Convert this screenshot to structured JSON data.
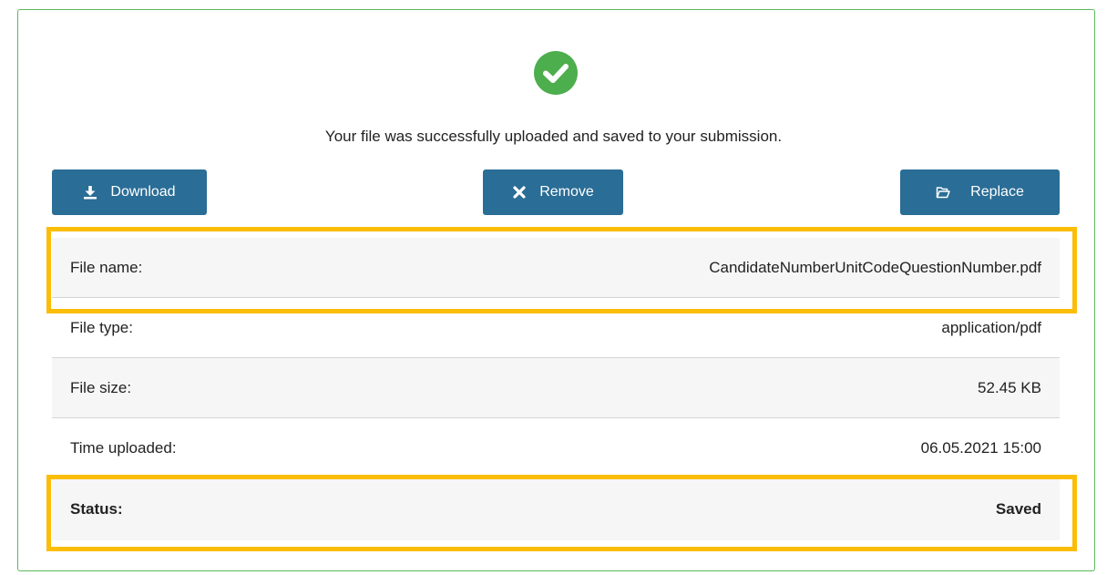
{
  "upload": {
    "message": "Your file was successfully uploaded and saved to your submission.",
    "success_icon": "check-circle-icon",
    "success_color": "#4cae4c"
  },
  "actions": {
    "download_label": "Download",
    "download_icon": "download-icon",
    "remove_label": "Remove",
    "remove_icon": "close-icon",
    "replace_label": "Replace",
    "replace_icon": "folder-open-icon",
    "button_color": "#2a6d96"
  },
  "details": {
    "rows": [
      {
        "label": "File name:",
        "value": "CandidateNumberUnitCodeQuestionNumber.pdf"
      },
      {
        "label": "File type:",
        "value": "application/pdf"
      },
      {
        "label": "File size:",
        "value": "52.45 KB"
      },
      {
        "label": "Time uploaded:",
        "value": "06.05.2021 15:00"
      },
      {
        "label": "Status:",
        "value": "Saved"
      }
    ]
  },
  "highlight_color": "#fbbd08",
  "frame_border_color": "#5cb85c"
}
